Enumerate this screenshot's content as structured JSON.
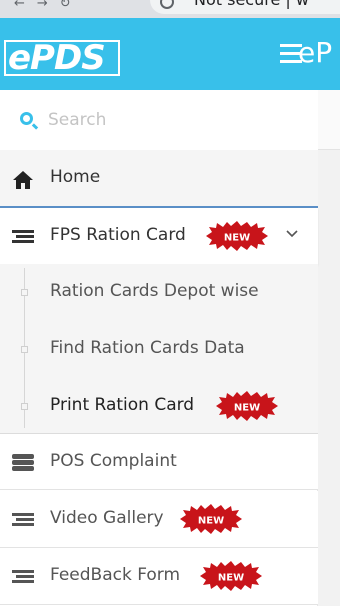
{
  "browser": {
    "address_text": "Not secure | w"
  },
  "header": {
    "logo_text": "ePDS",
    "title": "eP"
  },
  "search": {
    "placeholder": "Search"
  },
  "menu": {
    "home": {
      "label": "Home"
    },
    "fps": {
      "label": "FPS Ration Card",
      "badge": "NEW",
      "submenu": [
        {
          "label": "Ration Cards Depot wise"
        },
        {
          "label": "Find Ration Cards Data"
        },
        {
          "label": "Print Ration Card",
          "badge": "NEW"
        }
      ]
    },
    "pos": {
      "label": "POS Complaint"
    },
    "video": {
      "label": "Video Gallery",
      "badge": "NEW"
    },
    "feedback": {
      "label": "FeedBack Form",
      "badge": "NEW"
    }
  },
  "colors": {
    "header_bg": "#38c0ea",
    "badge_red": "#c8141a",
    "active_border": "#5a8fc7"
  }
}
